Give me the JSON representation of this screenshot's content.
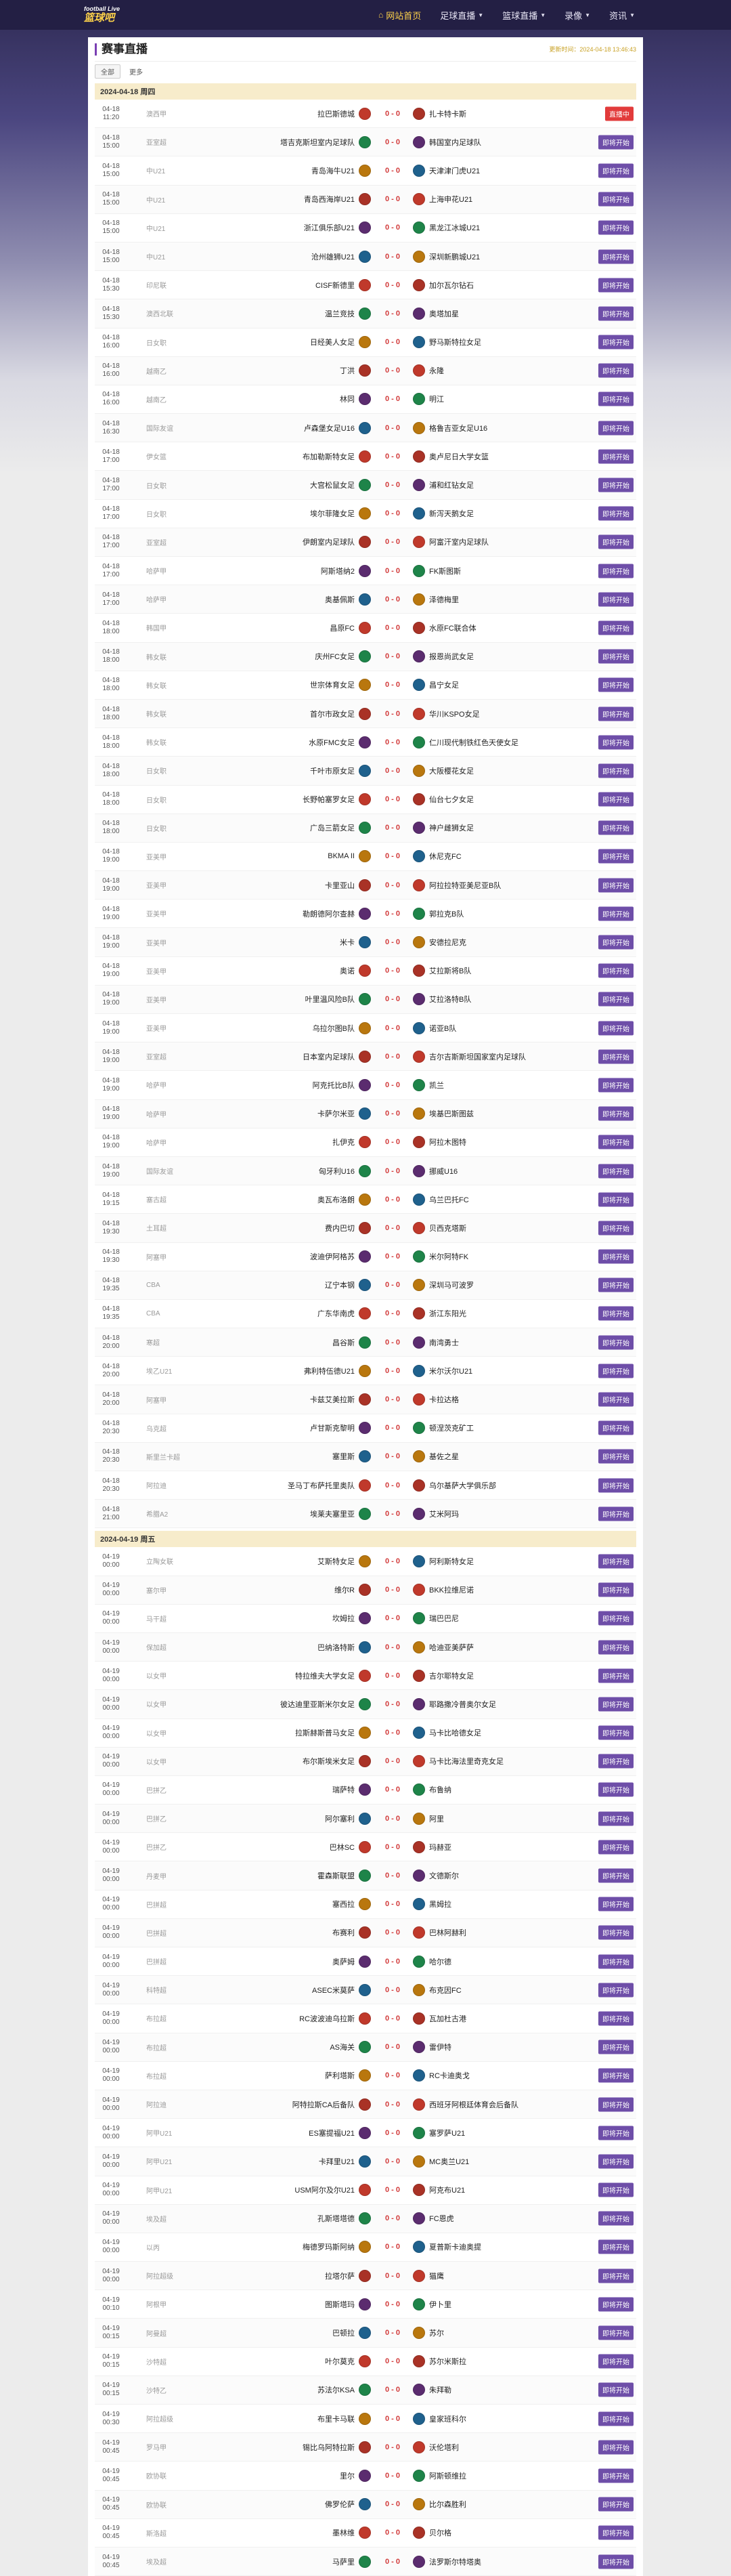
{
  "site": {
    "logo_top": "football Live",
    "logo_main": "篮球吧"
  },
  "nav": {
    "items": [
      {
        "label": "网站首页",
        "active": true
      },
      {
        "label": "足球直播",
        "dropdown": true
      },
      {
        "label": "篮球直播",
        "dropdown": true
      },
      {
        "label": "录像",
        "dropdown": true
      },
      {
        "label": "资讯",
        "dropdown": true
      }
    ]
  },
  "page": {
    "title": "赛事直播",
    "update_time": "更新时间：2024-04-18 13:46:43",
    "filters": [
      "全部",
      "更多"
    ]
  },
  "colors": {
    "accent": "#6e4ea8",
    "live": "#e23b3b",
    "score": "#d23b3b",
    "date_bar": "#f7eccb"
  },
  "sections": [
    {
      "date": "2024-04-18 周四",
      "matches": [
        {
          "time": "04-18\n11:20",
          "league": "澳西甲",
          "home": "拉巴斯德城",
          "away": "扎卡特卡斯",
          "score": "0 - 0",
          "status": "直播中",
          "live": true
        },
        {
          "time": "04-18\n15:00",
          "league": "亚室超",
          "home": "塔吉克斯坦室内足球队",
          "away": "韩国室内足球队",
          "score": "0 - 0",
          "status": "即将开始"
        },
        {
          "time": "04-18\n15:00",
          "league": "中U21",
          "home": "青岛海牛U21",
          "away": "天津津门虎U21",
          "score": "0 - 0",
          "status": "即将开始"
        },
        {
          "time": "04-18\n15:00",
          "league": "中U21",
          "home": "青岛西海岸U21",
          "away": "上海申花U21",
          "score": "0 - 0",
          "status": "即将开始"
        },
        {
          "time": "04-18\n15:00",
          "league": "中U21",
          "home": "浙江俱乐部U21",
          "away": "黑龙江冰城U21",
          "score": "0 - 0",
          "status": "即将开始"
        },
        {
          "time": "04-18\n15:00",
          "league": "中U21",
          "home": "沧州雄狮U21",
          "away": "深圳新鹏城U21",
          "score": "0 - 0",
          "status": "即将开始"
        },
        {
          "time": "04-18\n15:30",
          "league": "印尼联",
          "home": "CISF新德里",
          "away": "加尔瓦尔钻石",
          "score": "0 - 0",
          "status": "即将开始"
        },
        {
          "time": "04-18\n15:30",
          "league": "澳西北联",
          "home": "温兰竞技",
          "away": "奥塔加星",
          "score": "0 - 0",
          "status": "即将开始"
        },
        {
          "time": "04-18\n16:00",
          "league": "日女职",
          "home": "日经美人女足",
          "away": "野马斯特拉女足",
          "score": "0 - 0",
          "status": "即将开始"
        },
        {
          "time": "04-18\n16:00",
          "league": "越南乙",
          "home": "丁洪",
          "away": "永隆",
          "score": "0 - 0",
          "status": "即将开始"
        },
        {
          "time": "04-18\n16:00",
          "league": "越南乙",
          "home": "林同",
          "away": "明江",
          "score": "0 - 0",
          "status": "即将开始"
        },
        {
          "time": "04-18\n16:30",
          "league": "国际友谊",
          "home": "卢森堡女足U16",
          "away": "格鲁吉亚女足U16",
          "score": "0 - 0",
          "status": "即将开始"
        },
        {
          "time": "04-18\n17:00",
          "league": "伊女篮",
          "home": "布加勒斯特女足",
          "away": "奥卢尼日大学女篮",
          "score": "0 - 0",
          "status": "即将开始"
        },
        {
          "time": "04-18\n17:00",
          "league": "日女职",
          "home": "大宫松鼠女足",
          "away": "浦和红钻女足",
          "score": "0 - 0",
          "status": "即将开始"
        },
        {
          "time": "04-18\n17:00",
          "league": "日女职",
          "home": "埃尔菲隆女足",
          "away": "新泻天鹅女足",
          "score": "0 - 0",
          "status": "即将开始"
        },
        {
          "time": "04-18\n17:00",
          "league": "亚室超",
          "home": "伊朗室内足球队",
          "away": "阿富汗室内足球队",
          "score": "0 - 0",
          "status": "即将开始"
        },
        {
          "time": "04-18\n17:00",
          "league": "哈萨甲",
          "home": "阿斯塔纳2",
          "away": "FK斯图斯",
          "score": "0 - 0",
          "status": "即将开始"
        },
        {
          "time": "04-18\n17:00",
          "league": "哈萨甲",
          "home": "奥基佩斯",
          "away": "泽德梅里",
          "score": "0 - 0",
          "status": "即将开始"
        },
        {
          "time": "04-18\n18:00",
          "league": "韩国甲",
          "home": "昌原FC",
          "away": "水原FC联合体",
          "score": "0 - 0",
          "status": "即将开始"
        },
        {
          "time": "04-18\n18:00",
          "league": "韩女联",
          "home": "庆州FC女足",
          "away": "报恩尚武女足",
          "score": "0 - 0",
          "status": "即将开始"
        },
        {
          "time": "04-18\n18:00",
          "league": "韩女联",
          "home": "世宗体育女足",
          "away": "昌宁女足",
          "score": "0 - 0",
          "status": "即将开始"
        },
        {
          "time": "04-18\n18:00",
          "league": "韩女联",
          "home": "首尔市政女足",
          "away": "华川KSPO女足",
          "score": "0 - 0",
          "status": "即将开始"
        },
        {
          "time": "04-18\n18:00",
          "league": "韩女联",
          "home": "水原FMC女足",
          "away": "仁川现代制铁红色天使女足",
          "score": "0 - 0",
          "status": "即将开始"
        },
        {
          "time": "04-18\n18:00",
          "league": "日女职",
          "home": "千叶市原女足",
          "away": "大阪樱花女足",
          "score": "0 - 0",
          "status": "即将开始"
        },
        {
          "time": "04-18\n18:00",
          "league": "日女职",
          "home": "长野帕塞罗女足",
          "away": "仙台七夕女足",
          "score": "0 - 0",
          "status": "即将开始"
        },
        {
          "time": "04-18\n18:00",
          "league": "日女职",
          "home": "广岛三箭女足",
          "away": "神户雌狮女足",
          "score": "0 - 0",
          "status": "即将开始"
        },
        {
          "time": "04-18\n19:00",
          "league": "亚美甲",
          "home": "BKMA II",
          "away": "休尼克FC",
          "score": "0 - 0",
          "status": "即将开始"
        },
        {
          "time": "04-18\n19:00",
          "league": "亚美甲",
          "home": "卡里亚山",
          "away": "阿拉拉特亚美尼亚B队",
          "score": "0 - 0",
          "status": "即将开始"
        },
        {
          "time": "04-18\n19:00",
          "league": "亚美甲",
          "home": "勒朗德阿尔查赫",
          "away": "郭拉克B队",
          "score": "0 - 0",
          "status": "即将开始"
        },
        {
          "time": "04-18\n19:00",
          "league": "亚美甲",
          "home": "米卡",
          "away": "安德拉尼克",
          "score": "0 - 0",
          "status": "即将开始"
        },
        {
          "time": "04-18\n19:00",
          "league": "亚美甲",
          "home": "奥诺",
          "away": "艾拉斯将B队",
          "score": "0 - 0",
          "status": "即将开始"
        },
        {
          "time": "04-18\n19:00",
          "league": "亚美甲",
          "home": "叶里温风险B队",
          "away": "艾拉洛特B队",
          "score": "0 - 0",
          "status": "即将开始"
        },
        {
          "time": "04-18\n19:00",
          "league": "亚美甲",
          "home": "乌拉尔图B队",
          "away": "诺亚B队",
          "score": "0 - 0",
          "status": "即将开始"
        },
        {
          "time": "04-18\n19:00",
          "league": "亚室超",
          "home": "日本室内足球队",
          "away": "吉尔吉斯斯坦国家室内足球队",
          "score": "0 - 0",
          "status": "即将开始"
        },
        {
          "time": "04-18\n19:00",
          "league": "哈萨甲",
          "home": "阿克托比B队",
          "away": "凯兰",
          "score": "0 - 0",
          "status": "即将开始"
        },
        {
          "time": "04-18\n19:00",
          "league": "哈萨甲",
          "home": "卡萨尔米亚",
          "away": "埃基巴斯图兹",
          "score": "0 - 0",
          "status": "即将开始"
        },
        {
          "time": "04-18\n19:00",
          "league": "哈萨甲",
          "home": "扎伊克",
          "away": "阿拉木图特",
          "score": "0 - 0",
          "status": "即将开始"
        },
        {
          "time": "04-18\n19:00",
          "league": "国际友谊",
          "home": "匈牙利U16",
          "away": "挪威U16",
          "score": "0 - 0",
          "status": "即将开始"
        },
        {
          "time": "04-18\n19:15",
          "league": "塞古超",
          "home": "奥瓦布洛朗",
          "away": "乌兰巴托FC",
          "score": "0 - 0",
          "status": "即将开始"
        },
        {
          "time": "04-18\n19:30",
          "league": "土耳超",
          "home": "费内巴切",
          "away": "贝西克塔斯",
          "score": "0 - 0",
          "status": "即将开始"
        },
        {
          "time": "04-18\n19:30",
          "league": "阿塞甲",
          "home": "波迪伊阿格苏",
          "away": "米尔阿特FK",
          "score": "0 - 0",
          "status": "即将开始"
        },
        {
          "time": "04-18\n19:35",
          "league": "CBA",
          "home": "辽宁本钢",
          "away": "深圳马可波罗",
          "score": "0 - 0",
          "status": "即将开始"
        },
        {
          "time": "04-18\n19:35",
          "league": "CBA",
          "home": "广东华南虎",
          "away": "浙江东阳光",
          "score": "0 - 0",
          "status": "即将开始"
        },
        {
          "time": "04-18\n20:00",
          "league": "寒超",
          "home": "昌谷斯",
          "away": "南湾勇士",
          "score": "0 - 0",
          "status": "即将开始"
        },
        {
          "time": "04-18\n20:00",
          "league": "埃乙U21",
          "home": "弗利特伍德U21",
          "away": "米尔沃尔U21",
          "score": "0 - 0",
          "status": "即将开始"
        },
        {
          "time": "04-18\n20:00",
          "league": "阿塞甲",
          "home": "卡兹艾美拉斯",
          "away": "卡拉达格",
          "score": "0 - 0",
          "status": "即将开始"
        },
        {
          "time": "04-18\n20:30",
          "league": "乌克超",
          "home": "卢甘斯克黎明",
          "away": "顿涅茨克矿工",
          "score": "0 - 0",
          "status": "即将开始"
        },
        {
          "time": "04-18\n20:30",
          "league": "斯里兰卡超",
          "home": "塞里斯",
          "away": "基佐之星",
          "score": "0 - 0",
          "status": "即将开始"
        },
        {
          "time": "04-18\n20:30",
          "league": "阿拉迪",
          "home": "圣马丁布萨托里奥队",
          "away": "乌尔基萨大学俱乐部",
          "score": "0 - 0",
          "status": "即将开始"
        },
        {
          "time": "04-18\n21:00",
          "league": "希腊A2",
          "home": "埃莱夫塞里亚",
          "away": "艾米阿玛",
          "score": "0 - 0",
          "status": "即将开始"
        }
      ]
    },
    {
      "date": "2024-04-19 周五",
      "matches": [
        {
          "time": "04-19\n00:00",
          "league": "立陶女联",
          "home": "艾斯特女足",
          "away": "阿利斯特女足",
          "score": "0 - 0",
          "status": "即将开始"
        },
        {
          "time": "04-19\n00:00",
          "league": "塞尔甲",
          "home": "维尔R",
          "away": "BKK拉维尼诺",
          "score": "0 - 0",
          "status": "即将开始"
        },
        {
          "time": "04-19\n00:00",
          "league": "马干超",
          "home": "坎姆拉",
          "away": "瑞巴巴尼",
          "score": "0 - 0",
          "status": "即将开始"
        },
        {
          "time": "04-19\n00:00",
          "league": "保加超",
          "home": "巴纳洛特斯",
          "away": "哈迪亚美萨萨",
          "score": "0 - 0",
          "status": "即将开始"
        },
        {
          "time": "04-19\n00:00",
          "league": "以女甲",
          "home": "特拉维夫大学女足",
          "away": "吉尔耶特女足",
          "score": "0 - 0",
          "status": "即将开始"
        },
        {
          "time": "04-19\n00:00",
          "league": "以女甲",
          "home": "彼达迪里亚斯米尔女足",
          "away": "耶路撒冷普奥尔女足",
          "score": "0 - 0",
          "status": "即将开始"
        },
        {
          "time": "04-19\n00:00",
          "league": "以女甲",
          "home": "拉斯赫斯普马女足",
          "away": "马卡比哈德女足",
          "score": "0 - 0",
          "status": "即将开始"
        },
        {
          "time": "04-19\n00:00",
          "league": "以女甲",
          "home": "布尔斯埃米女足",
          "away": "马卡比海法里奇克女足",
          "score": "0 - 0",
          "status": "即将开始"
        },
        {
          "time": "04-19\n00:00",
          "league": "巴拼乙",
          "home": "瑞萨特",
          "away": "布鲁纳",
          "score": "0 - 0",
          "status": "即将开始"
        },
        {
          "time": "04-19\n00:00",
          "league": "巴拼乙",
          "home": "阿尔塞利",
          "away": "阿里",
          "score": "0 - 0",
          "status": "即将开始"
        },
        {
          "time": "04-19\n00:00",
          "league": "巴拼乙",
          "home": "巴林SC",
          "away": "玛赫亚",
          "score": "0 - 0",
          "status": "即将开始"
        },
        {
          "time": "04-19\n00:00",
          "league": "丹麦甲",
          "home": "霍森斯联盟",
          "away": "文德斯尔",
          "score": "0 - 0",
          "status": "即将开始"
        },
        {
          "time": "04-19\n00:00",
          "league": "巴拼超",
          "home": "塞西拉",
          "away": "黑姆拉",
          "score": "0 - 0",
          "status": "即将开始"
        },
        {
          "time": "04-19\n00:00",
          "league": "巴拼超",
          "home": "布赛利",
          "away": "巴林阿赫利",
          "score": "0 - 0",
          "status": "即将开始"
        },
        {
          "time": "04-19\n00:00",
          "league": "巴拼超",
          "home": "奥萨姆",
          "away": "哈尔德",
          "score": "0 - 0",
          "status": "即将开始"
        },
        {
          "time": "04-19\n00:00",
          "league": "科特超",
          "home": "ASEC米莫萨",
          "away": "布克因FC",
          "score": "0 - 0",
          "status": "即将开始"
        },
        {
          "time": "04-19\n00:00",
          "league": "布拉超",
          "home": "RC波波迪乌拉斯",
          "away": "瓦加杜古港",
          "score": "0 - 0",
          "status": "即将开始"
        },
        {
          "time": "04-19\n00:00",
          "league": "布拉超",
          "home": "AS海关",
          "away": "雷伊特",
          "score": "0 - 0",
          "status": "即将开始"
        },
        {
          "time": "04-19\n00:00",
          "league": "布拉超",
          "home": "萨利塔斯",
          "away": "RC卡迪奥戈",
          "score": "0 - 0",
          "status": "即将开始"
        },
        {
          "time": "04-19\n00:00",
          "league": "阿拉迪",
          "home": "阿特拉斯CA后备队",
          "away": "西班牙阿根廷体育会后备队",
          "score": "0 - 0",
          "status": "即将开始"
        },
        {
          "time": "04-19\n00:00",
          "league": "阿甲U21",
          "home": "ES塞提福U21",
          "away": "塞罗萨U21",
          "score": "0 - 0",
          "status": "即将开始"
        },
        {
          "time": "04-19\n00:00",
          "league": "阿甲U21",
          "home": "卡拜里U21",
          "away": "MC奥兰U21",
          "score": "0 - 0",
          "status": "即将开始"
        },
        {
          "time": "04-19\n00:00",
          "league": "阿甲U21",
          "home": "USM阿尔及尔U21",
          "away": "阿克布U21",
          "score": "0 - 0",
          "status": "即将开始"
        },
        {
          "time": "04-19\n00:00",
          "league": "埃及超",
          "home": "孔斯塔塔德",
          "away": "FC恩虎",
          "score": "0 - 0",
          "status": "即将开始"
        },
        {
          "time": "04-19\n00:00",
          "league": "以丙",
          "home": "梅德罗玛斯阿纳",
          "away": "夏普斯卡迪奥提",
          "score": "0 - 0",
          "status": "即将开始"
        },
        {
          "time": "04-19\n00:00",
          "league": "阿拉超级",
          "home": "拉塔尔萨",
          "away": "猫鹰",
          "score": "0 - 0",
          "status": "即将开始"
        },
        {
          "time": "04-19\n00:10",
          "league": "阿根甲",
          "home": "图斯塔玛",
          "away": "伊卜里",
          "score": "0 - 0",
          "status": "即将开始"
        },
        {
          "time": "04-19\n00:15",
          "league": "阿曼超",
          "home": "巴顿拉",
          "away": "苏尔",
          "score": "0 - 0",
          "status": "即将开始"
        },
        {
          "time": "04-19\n00:15",
          "league": "沙特超",
          "home": "叶尔莫克",
          "away": "苏尔米斯拉",
          "score": "0 - 0",
          "status": "即将开始"
        },
        {
          "time": "04-19\n00:15",
          "league": "沙特乙",
          "home": "苏法尔KSA",
          "away": "朱拜勒",
          "score": "0 - 0",
          "status": "即将开始"
        },
        {
          "time": "04-19\n00:30",
          "league": "阿拉超级",
          "home": "布里卡马联",
          "away": "皇家班科尔",
          "score": "0 - 0",
          "status": "即将开始"
        },
        {
          "time": "04-19\n00:45",
          "league": "罗马甲",
          "home": "锡比乌阿特拉斯",
          "away": "沃伦塔利",
          "score": "0 - 0",
          "status": "即将开始"
        },
        {
          "time": "04-19\n00:45",
          "league": "欧协联",
          "home": "里尔",
          "away": "阿斯顿维拉",
          "score": "0 - 0",
          "status": "即将开始"
        },
        {
          "time": "04-19\n00:45",
          "league": "欧协联",
          "home": "佛罗伦萨",
          "away": "比尔森胜利",
          "score": "0 - 0",
          "status": "即将开始"
        },
        {
          "time": "04-19\n00:45",
          "league": "斯洛超",
          "home": "墨林维",
          "away": "贝尔格",
          "score": "0 - 0",
          "status": "即将开始"
        },
        {
          "time": "04-19\n00:45",
          "league": "埃及超",
          "home": "马萨里",
          "away": "法罗斯尔特塔奥",
          "score": "0 - 0",
          "status": "即将开始"
        }
      ]
    }
  ]
}
